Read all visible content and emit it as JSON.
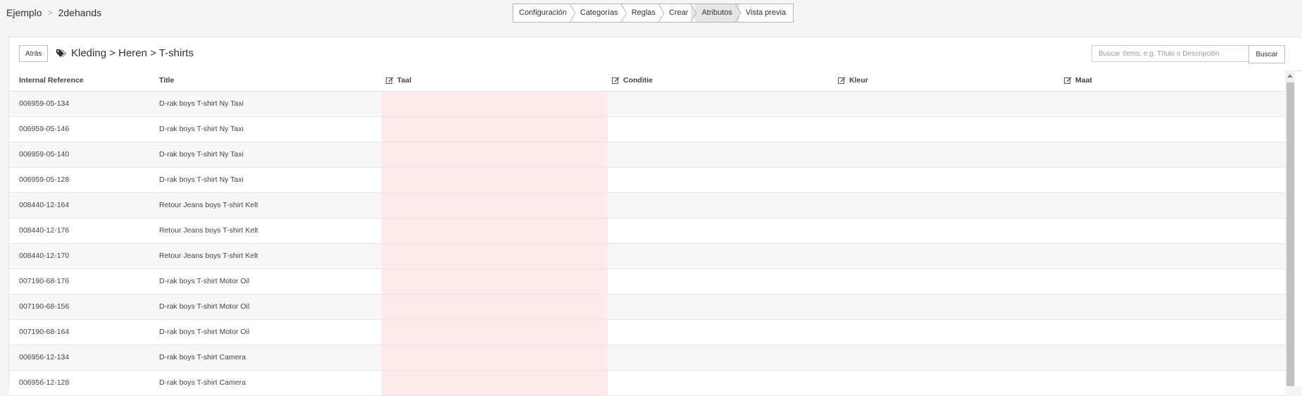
{
  "breadcrumb": {
    "root": "Ejemplo",
    "separator": ">",
    "current": "2dehands"
  },
  "wizard": {
    "steps": [
      "Configuración",
      "Categorías",
      "Reglas",
      "Crear",
      "Atributos",
      "Vista previa"
    ],
    "active_step": "Atributos"
  },
  "toolbar": {
    "back_label": "Atrás",
    "category_icon": "tags-icon",
    "category_path": "Kleding > Heren > T-shirts",
    "search_placeholder": "Buscar ítems, e.g. Título o Descripción",
    "search_button": "Buscar"
  },
  "table": {
    "columns": {
      "internal_reference": "Internal Reference",
      "title": "Title",
      "taal": "Taal",
      "conditie": "Conditie",
      "kleur": "Kleur",
      "maat": "Maat"
    },
    "attribute_icon": "edit-checkbox-icon",
    "highlight_color": "#fdeaea",
    "rows": [
      {
        "ref": "006959-05-134",
        "title": "D-rak boys T-shirt Ny Taxi"
      },
      {
        "ref": "006959-05-146",
        "title": "D-rak boys T-shirt Ny Taxi"
      },
      {
        "ref": "006959-05-140",
        "title": "D-rak boys T-shirt Ny Taxi"
      },
      {
        "ref": "006959-05-128",
        "title": "D-rak boys T-shirt Ny Taxi"
      },
      {
        "ref": "008440-12-164",
        "title": "Retour Jeans boys T-shirt Kelt"
      },
      {
        "ref": "008440-12-176",
        "title": "Retour Jeans boys T-shirt Kelt"
      },
      {
        "ref": "008440-12-170",
        "title": "Retour Jeans boys T-shirt Kelt"
      },
      {
        "ref": "007190-68-176",
        "title": "D-rak boys T-shirt Motor Oil"
      },
      {
        "ref": "007190-68-156",
        "title": "D-rak boys T-shirt Motor Oil"
      },
      {
        "ref": "007190-68-164",
        "title": "D-rak boys T-shirt Motor Oil"
      },
      {
        "ref": "006956-12-134",
        "title": "D-rak boys T-shirt Camera"
      },
      {
        "ref": "006956-12-128",
        "title": "D-rak boys T-shirt Camera"
      }
    ]
  }
}
